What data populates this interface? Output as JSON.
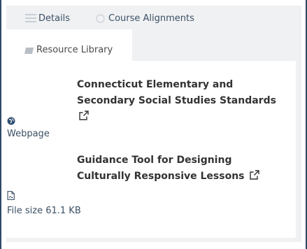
{
  "tabs": {
    "details_label": "Details",
    "alignments_label": "Course Alignments",
    "library_label": "Resource Library"
  },
  "resources": [
    {
      "title_line1": "Connecticut Elementary and",
      "title_line2": "Secondary Social Studies Standards",
      "type_label": "Webpage",
      "icon": "globe-icon"
    },
    {
      "title_line1": "Guidance Tool for Designing",
      "title_line2": "Culturally Responsive Lessons",
      "type_label": "File size 61.1 KB",
      "icon": "pdf-file-icon"
    }
  ],
  "colors": {
    "border": "#2e4a66",
    "panel_bg": "#f0f1f3",
    "title_text": "#333333",
    "meta_text": "#3a4f63"
  }
}
